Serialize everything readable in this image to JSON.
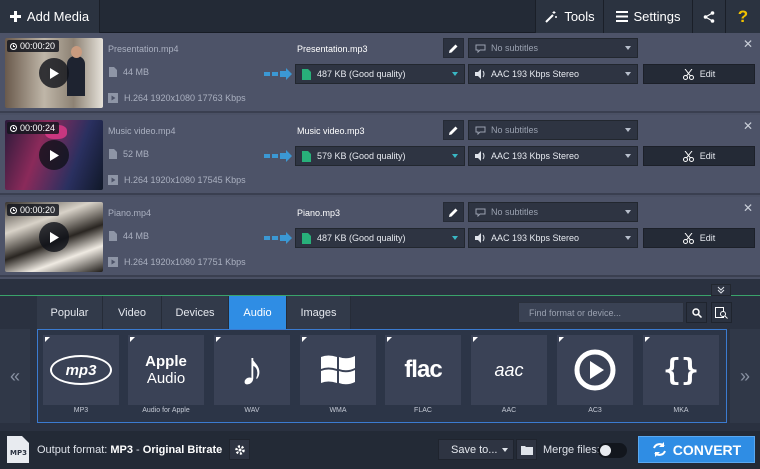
{
  "toolbar": {
    "add_media": "Add Media",
    "tools": "Tools",
    "settings": "Settings"
  },
  "files": [
    {
      "duration": "00:00:20",
      "source_name": "Presentation.mp4",
      "source_size": "44 MB",
      "source_codec": "H.264 1920x1080 17763 Kbps",
      "output_name": "Presentation.mp3",
      "quality": "487 KB (Good quality)",
      "subtitles": "No subtitles",
      "audio": "AAC 193 Kbps Stereo",
      "edit": "Edit"
    },
    {
      "duration": "00:00:24",
      "source_name": "Music video.mp4",
      "source_size": "52 MB",
      "source_codec": "H.264 1920x1080 17545 Kbps",
      "output_name": "Music video.mp3",
      "quality": "579 KB (Good quality)",
      "subtitles": "No subtitles",
      "audio": "AAC 193 Kbps Stereo",
      "edit": "Edit"
    },
    {
      "duration": "00:00:20",
      "source_name": "Piano.mp4",
      "source_size": "44 MB",
      "source_codec": "H.264 1920x1080 17751 Kbps",
      "output_name": "Piano.mp3",
      "quality": "487 KB (Good quality)",
      "subtitles": "No subtitles",
      "audio": "AAC 193 Kbps Stereo",
      "edit": "Edit"
    }
  ],
  "tabs": [
    "Popular",
    "Video",
    "Devices",
    "Audio",
    "Images"
  ],
  "active_tab": "Audio",
  "search": {
    "placeholder": "Find format or device..."
  },
  "formats": [
    {
      "label": "MP3",
      "logo": "mp3"
    },
    {
      "label": "Audio for Apple",
      "logo_line1": "Apple",
      "logo_line2": "Audio"
    },
    {
      "label": "WAV",
      "icon": "music-note-icon"
    },
    {
      "label": "WMA",
      "icon": "windows-logo-icon"
    },
    {
      "label": "FLAC",
      "logo": "flac"
    },
    {
      "label": "AAC",
      "logo": "aac"
    },
    {
      "label": "AC3",
      "icon": "play-circle-icon"
    },
    {
      "label": "MKA",
      "icon": "braces-icon"
    }
  ],
  "bottom": {
    "output_label": "Output format:",
    "output_format": "MP3",
    "output_sep": " - ",
    "output_bitrate": "Original Bitrate",
    "save_to": "Save to...",
    "merge_files": "Merge files:",
    "convert": "CONVERT"
  },
  "colors": {
    "accent": "#2f8de4",
    "arrow": "#3aa0e0",
    "quality_accent": "#39b7c4",
    "divider": "#3aa36a"
  }
}
